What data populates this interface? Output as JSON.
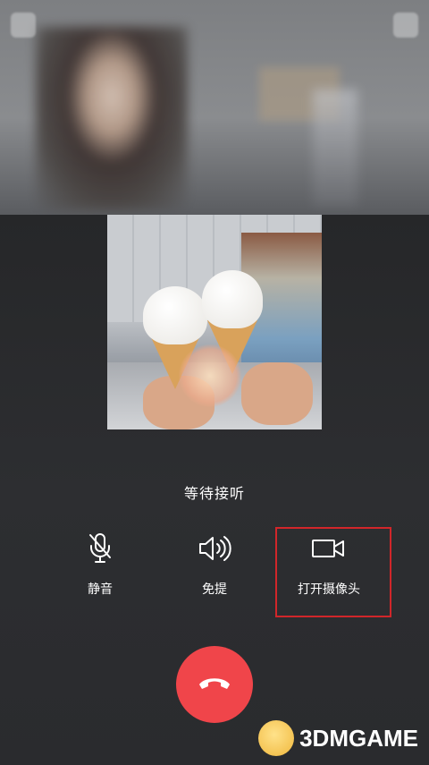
{
  "call": {
    "status_text": "等待接听"
  },
  "controls": {
    "mute": {
      "label": "静音",
      "icon": "microphone-muted-icon"
    },
    "speaker": {
      "label": "免提",
      "icon": "speaker-icon"
    },
    "camera": {
      "label": "打开摄像头",
      "icon": "video-camera-icon"
    },
    "hangup": {
      "icon": "phone-hangup-icon"
    }
  },
  "watermark": {
    "text": "3DMGAME"
  },
  "colors": {
    "hangup_red": "#f0454a",
    "highlight_red": "#d1262a",
    "background": "#2b2c2f"
  }
}
